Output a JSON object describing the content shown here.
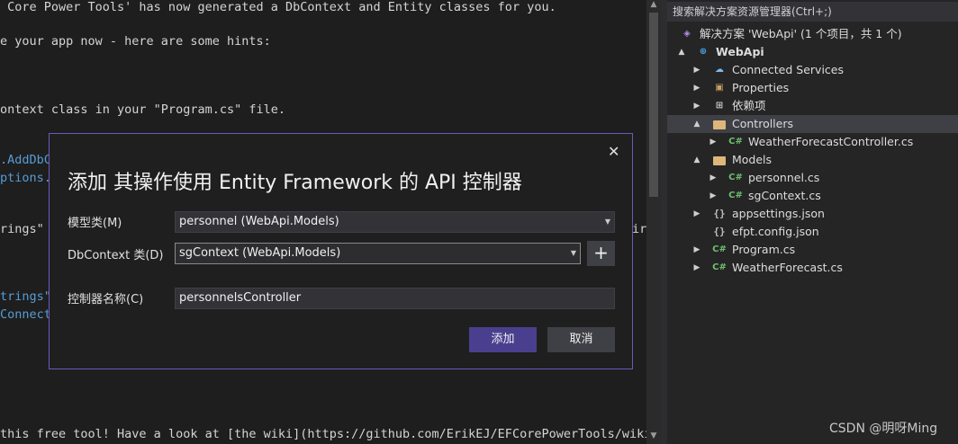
{
  "editor": {
    "lines": [
      {
        "text": " Core Power Tools' has now generated a DbContext and Entity classes for you.",
        "color": "#d4d4d4"
      },
      {
        "text": "e your app now - here are some hints:",
        "color": "#d4d4d4"
      },
      {
        "text": "ontext class in your \"Program.cs\" file.",
        "color": "#d4d4d4"
      },
      {
        "text": ".AddDbC",
        "color": "#569cd6"
      },
      {
        "text": "ptions.",
        "color": "#569cd6"
      },
      {
        "text": "rings\"",
        "color": "#d4d4d4"
      },
      {
        "text": "ir",
        "color": "#d4d4d4"
      },
      {
        "text": "trings\"",
        "color": "#569cd6"
      },
      {
        "text": "Connect",
        "color": "#569cd6"
      },
      {
        "text": "this free tool! Have a look at [the wiki](https://github.com/ErikEJ/EFCorePowerTools/wiki/",
        "color": "#d4d4d4"
      }
    ]
  },
  "solution_explorer": {
    "search_placeholder": "搜索解决方案资源管理器(Ctrl+;)",
    "items": [
      {
        "label": "解决方案 'WebApi' (1 个项目，共 1 个)",
        "icon": "solution-icon",
        "arrow": ""
      },
      {
        "label": "WebApi",
        "icon": "project-globe-icon",
        "arrow": "▲"
      },
      {
        "label": "Connected Services",
        "icon": "connected-services-icon",
        "arrow": "▶"
      },
      {
        "label": "Properties",
        "icon": "properties-wrench-icon",
        "arrow": "▶"
      },
      {
        "label": "依赖项",
        "icon": "dependencies-icon",
        "arrow": "▶"
      },
      {
        "label": "Controllers",
        "icon": "folder-icon",
        "arrow": "▲"
      },
      {
        "label": "WeatherForecastController.cs",
        "icon": "csharp-file-icon",
        "arrow": "▶"
      },
      {
        "label": "Models",
        "icon": "folder-icon",
        "arrow": "▲"
      },
      {
        "label": "personnel.cs",
        "icon": "csharp-file-icon",
        "arrow": "▶"
      },
      {
        "label": "sgContext.cs",
        "icon": "csharp-file-icon",
        "arrow": "▶"
      },
      {
        "label": "appsettings.json",
        "icon": "json-file-icon",
        "arrow": "▶"
      },
      {
        "label": "efpt.config.json",
        "icon": "json-file-icon",
        "arrow": ""
      },
      {
        "label": "Program.cs",
        "icon": "csharp-file-icon",
        "arrow": "▶"
      },
      {
        "label": "WeatherForecast.cs",
        "icon": "csharp-file-icon",
        "arrow": "▶"
      }
    ],
    "selected_label": "Controllers"
  },
  "dialog": {
    "title": "添加 其操作使用 Entity Framework 的 API 控制器",
    "close_glyph": "✕",
    "model_class_label": "模型类(M)",
    "model_class_value": "personnel (WebApi.Models)",
    "dbcontext_label": "DbContext 类(D)",
    "dbcontext_value": "sgContext (WebApi.Models)",
    "add_dbcontext_glyph": "+",
    "controller_name_label": "控制器名称(C)",
    "controller_name_value": "personnelsController",
    "add_button": "添加",
    "cancel_button": "取消"
  },
  "watermark": "CSDN @明呀Ming",
  "colors": {
    "accent": "#6c5ab8",
    "primary_button": "#4a3f8f",
    "csharp_icon": "#6fbf6f",
    "folder_icon": "#dcb67a"
  }
}
